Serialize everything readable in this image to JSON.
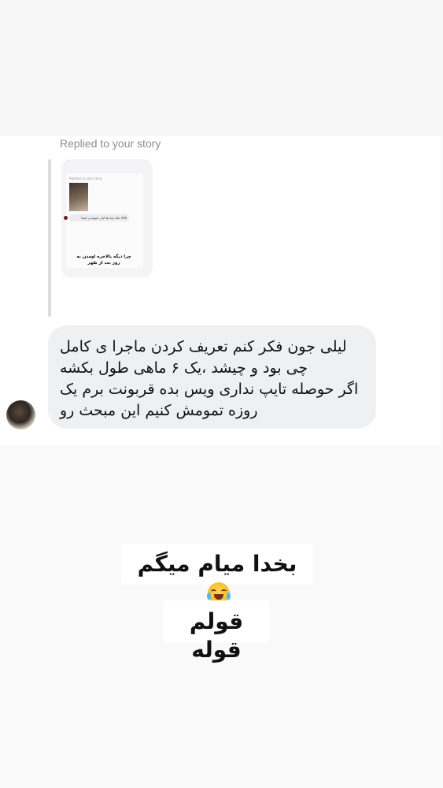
{
  "story_reply": {
    "label": "Replied to your story",
    "thumbnail": {
      "header": "Replied to your story",
      "reply_text": "اااااا حکه بچه ها ایان نمیومدن اینجا",
      "caption": "چرا دیگه بالاخره اومدن به روز بعد از ظهر"
    }
  },
  "message": {
    "lines": [
      "لیلی جون فکر کنم تعریف کردن ماجرا ی کامل",
      "چی بود و چیشد ،یک ۶ ماهی طول بکشه",
      "اگر حوصله تایپ نداری ویس بده قربونت برم یک",
      "روزه تمومش کنیم این مبحث رو"
    ]
  },
  "stickers": {
    "first": "بخدا میام میگم",
    "first_emoji": "face-with-tears-of-joy-icon",
    "second": "قولم قوله"
  }
}
